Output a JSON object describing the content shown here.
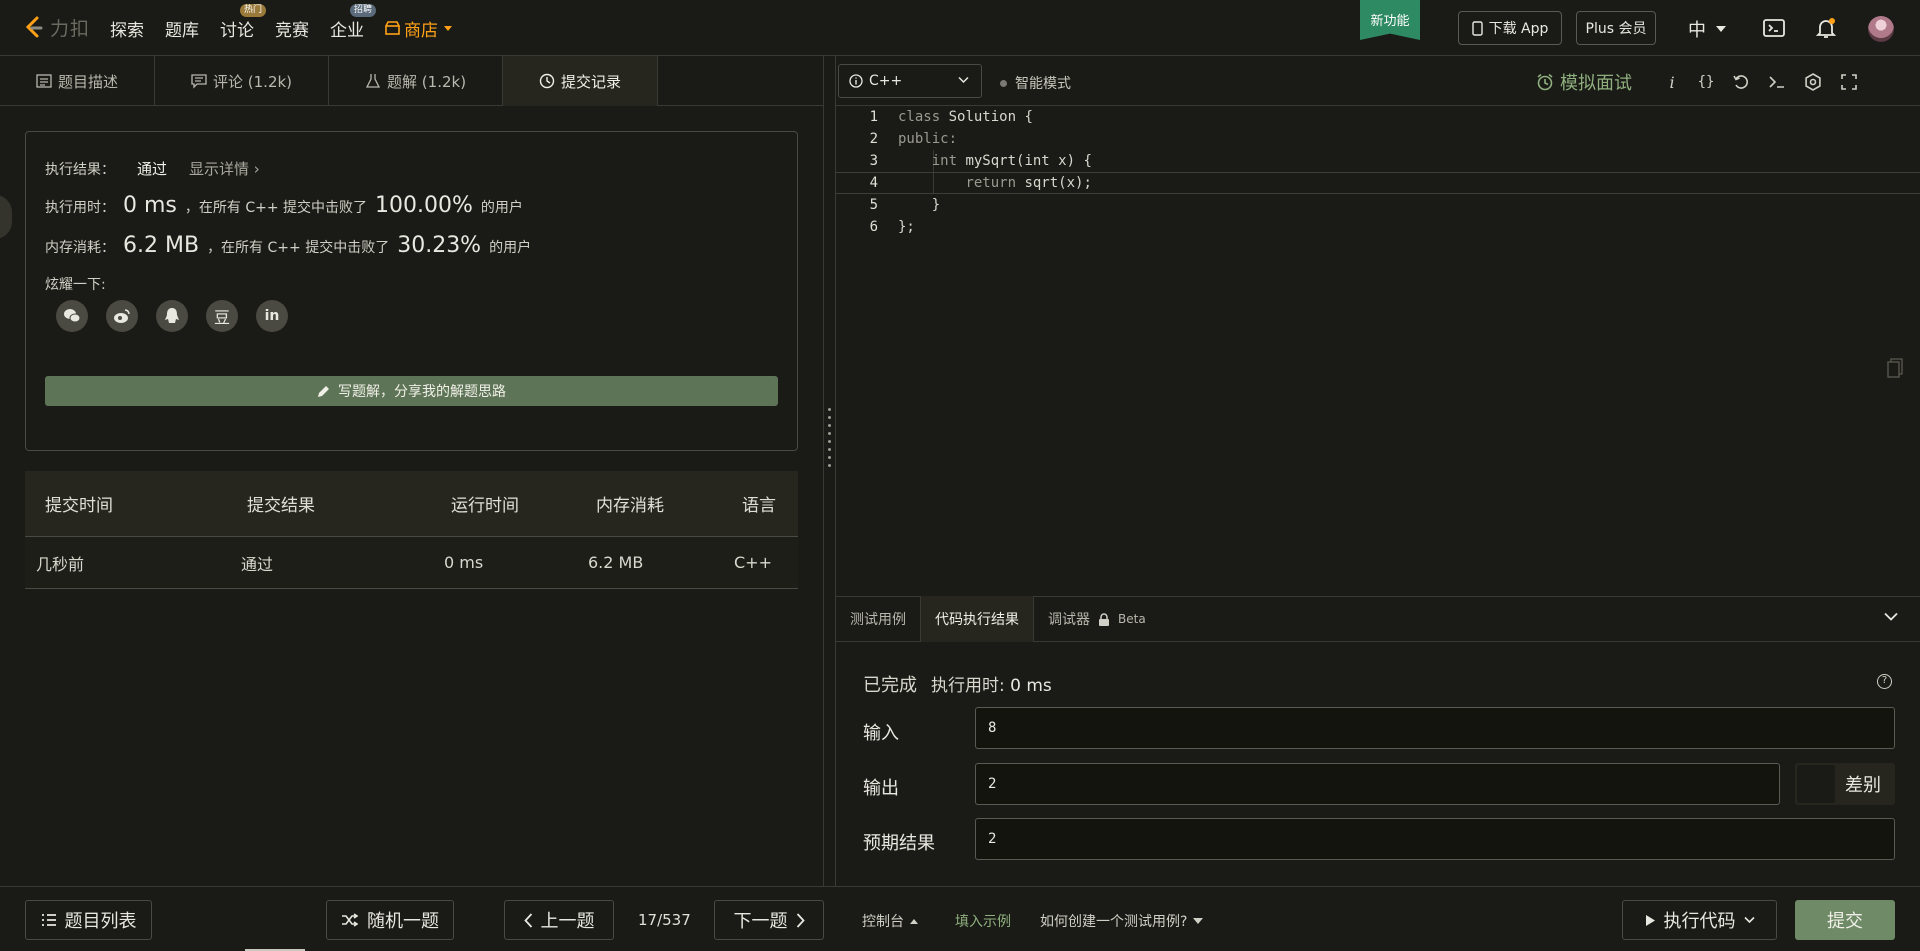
{
  "nav": {
    "logo_text": "力扣",
    "links": [
      {
        "label": "探索"
      },
      {
        "label": "题库"
      },
      {
        "label": "讨论",
        "badge": "热门"
      },
      {
        "label": "竞赛"
      },
      {
        "label": "企业",
        "badge": "招聘"
      }
    ],
    "store_label": "商店",
    "new_feature": "新功能",
    "download_app": "下载 App",
    "plus": "Plus 会员",
    "lang": "中"
  },
  "left_tabs": [
    {
      "label": "题目描述",
      "icon": "description-icon"
    },
    {
      "label": "评论 (1.2k)",
      "icon": "comment-icon"
    },
    {
      "label": "题解 (1.2k)",
      "icon": "flask-icon"
    },
    {
      "label": "提交记录",
      "icon": "clock-icon",
      "active": true
    }
  ],
  "result": {
    "status_label": "执行结果：",
    "status": "通过",
    "detail_link": "显示详情",
    "time_label": "执行用时：",
    "time_value": "0 ms",
    "time_mid": "，在所有 C++ 提交中击败了",
    "time_pct": "100.00%",
    "time_suffix": "的用户",
    "mem_label": "内存消耗：",
    "mem_value": "6.2 MB",
    "mem_mid": "，在所有 C++ 提交中击败了",
    "mem_pct": "30.23%",
    "mem_suffix": "的用户",
    "share_label": "炫耀一下:",
    "share_icons": [
      "wechat-icon",
      "weibo-icon",
      "qq-icon",
      "douban-icon",
      "linkedin-icon"
    ],
    "write_solution": "写题解，分享我的解题思路"
  },
  "submissions": {
    "headers": [
      "提交时间",
      "提交结果",
      "运行时间",
      "内存消耗",
      "语言"
    ],
    "rows": [
      [
        "几秒前",
        "通过",
        "0 ms",
        "6.2 MB",
        "C++"
      ]
    ]
  },
  "editor": {
    "language": "C++",
    "smart_mode": "智能模式",
    "mock_interview": "模拟面试",
    "code_lines": [
      {
        "n": "1",
        "kw": "class",
        "rest": " Solution {"
      },
      {
        "n": "2",
        "kw": "public:",
        "rest": ""
      },
      {
        "n": "3",
        "pre": "    ",
        "kw": "int",
        "rest": " mySqrt(int x) {"
      },
      {
        "n": "4",
        "pre": "        ",
        "kw": "return",
        "rest": " sqrt(x);"
      },
      {
        "n": "5",
        "pre": "    ",
        "kw": "",
        "rest": "}"
      },
      {
        "n": "6",
        "kw": "",
        "rest": "};"
      }
    ]
  },
  "console": {
    "tabs": [
      "测试用例",
      "代码执行结果",
      "调试器"
    ],
    "beta": "Beta",
    "finished": "已完成",
    "runtime_label": "执行用时:",
    "runtime_value": "0 ms",
    "input_label": "输入",
    "input_value": "8",
    "output_label": "输出",
    "output_value": "2",
    "expected_label": "预期结果",
    "expected_value": "2",
    "diff_label": "差别"
  },
  "bottom": {
    "problem_list": "题目列表",
    "random": "随机一题",
    "prev": "上一题",
    "page": "17/537",
    "next": "下一题",
    "console": "控制台",
    "fill_example": "填入示例",
    "how_to_test": "如何创建一个测试用例?",
    "run_code": "执行代码",
    "submit": "提交"
  }
}
